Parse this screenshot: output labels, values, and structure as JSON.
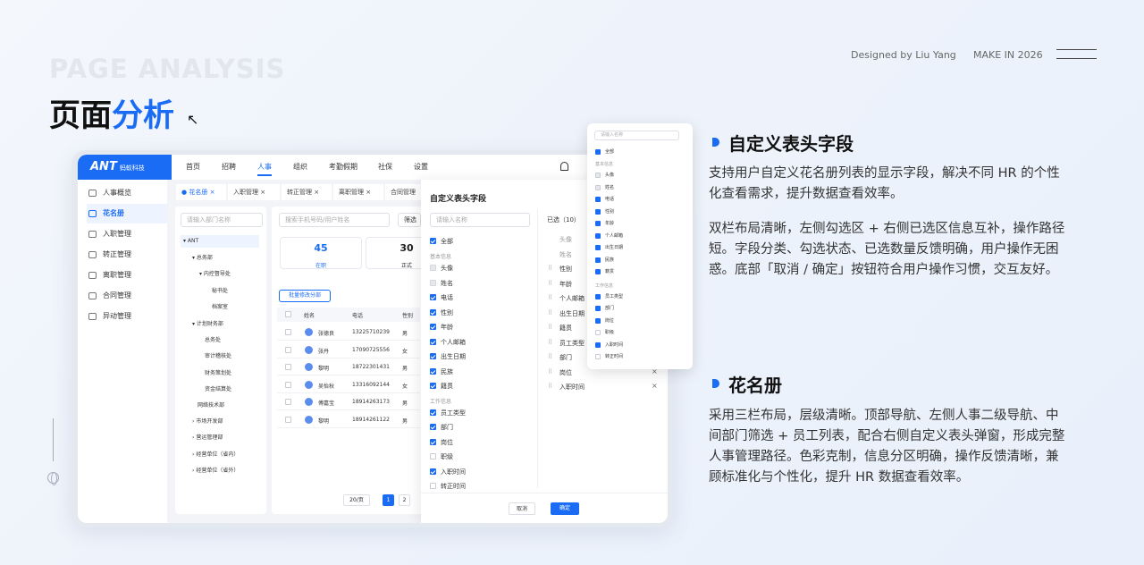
{
  "header": {
    "ghost": "PAGE ANALYSIS",
    "title_a": "页面",
    "title_b": "分析",
    "arrow": "↖",
    "credit": "Designed by Liu Yang",
    "make": "MAKE IN 2026"
  },
  "app": {
    "logo": "ANT",
    "logo_sub": "蚂蚁科技",
    "nav": [
      "首页",
      "招聘",
      "人事",
      "组织",
      "考勤假期",
      "社保",
      "设置"
    ],
    "menu": [
      "人事概览",
      "花名册",
      "入职管理",
      "转正管理",
      "离职管理",
      "合同管理",
      "异动管理"
    ],
    "tabs": [
      "花名册",
      "入职管理",
      "转正管理",
      "离职管理",
      "合同管理"
    ],
    "dept_placeholder": "请输入部门名称",
    "tree": [
      "ANT",
      "总务部",
      "内控督导处",
      "秘书处",
      "档案室",
      "计划财务部",
      "总务处",
      "审计稽核处",
      "财务策划处",
      "资金结算处",
      "网络技术部",
      "市场开发部",
      "营运管理部",
      "经营单位（省内）",
      "经营单位（省外）"
    ],
    "search_placeholder": "搜索手机号码/用户姓名",
    "filter": "筛选",
    "stats": [
      {
        "value": "45",
        "label": "在职"
      },
      {
        "value": "30",
        "label": "正式"
      }
    ],
    "batch": "批量修改分部",
    "columns": [
      "姓名",
      "电话",
      "性别"
    ],
    "rows": [
      {
        "name": "张德良",
        "phone": "13225710239",
        "sex": "男"
      },
      {
        "name": "张丹",
        "phone": "17090725556",
        "sex": "女"
      },
      {
        "name": "黎明",
        "phone": "18722301431",
        "sex": "男"
      },
      {
        "name": "吴怡秋",
        "phone": "13316092144",
        "sex": "女"
      },
      {
        "name": "傅嘉宝",
        "phone": "18914263173",
        "sex": "男"
      },
      {
        "name": "黎明",
        "phone": "18914261122",
        "sex": "男"
      }
    ],
    "page_size": "20/页",
    "pages": [
      "1",
      "2"
    ]
  },
  "modal": {
    "title": "自定义表头字段",
    "placeholder": "请输入名称",
    "all": "全部",
    "group1": "基本信息",
    "left": [
      "头像",
      "姓名",
      "电话",
      "性别",
      "年龄",
      "个人邮箱",
      "出生日期",
      "民族",
      "籍贯"
    ],
    "group2": "工作信息",
    "left2": [
      "员工类型",
      "部门",
      "岗位",
      "职级",
      "入职时间",
      "转正时间"
    ],
    "selected_label": "已选（10）",
    "right": [
      "头像",
      "姓名",
      "性别",
      "年龄",
      "个人邮箱",
      "出生日期",
      "籍贯",
      "员工类型",
      "部门",
      "岗位",
      "入职时间"
    ],
    "cancel": "取消",
    "ok": "确定"
  },
  "popup": {
    "placeholder": "请输入名称",
    "all": "全部",
    "group1": "基本信息",
    "items1": [
      "头像",
      "姓名",
      "电话",
      "性别",
      "年龄",
      "个人邮箱",
      "出生日期",
      "民族",
      "籍贯"
    ],
    "group2": "工作信息",
    "items2": [
      "员工类型",
      "部门",
      "岗位",
      "职级",
      "入职时间",
      "转正时间"
    ]
  },
  "sections": [
    {
      "title": "自定义表头字段",
      "p1": "支持用户自定义花名册列表的显示字段，解决不同 HR 的个性化查看需求，提升数据查看效率。",
      "p2": "双栏布局清晰，左侧勾选区 + 右侧已选区信息互补，操作路径短。字段分类、勾选状态、已选数量反馈明确，用户操作无困惑。底部「取消 / 确定」按钮符合用户操作习惯，交互友好。"
    },
    {
      "title": "花名册",
      "p1": "采用三栏布局，层级清晰。顶部导航、左侧人事二级导航、中间部门筛选 + 员工列表，配合右侧自定义表头弹窗，形成完整人事管理路径。色彩克制，信息分区明确，操作反馈清晰，兼顾标准化与个性化，提升 HR 数据查看效率。"
    }
  ],
  "colors": {
    "accent": "#1a6cf5"
  }
}
